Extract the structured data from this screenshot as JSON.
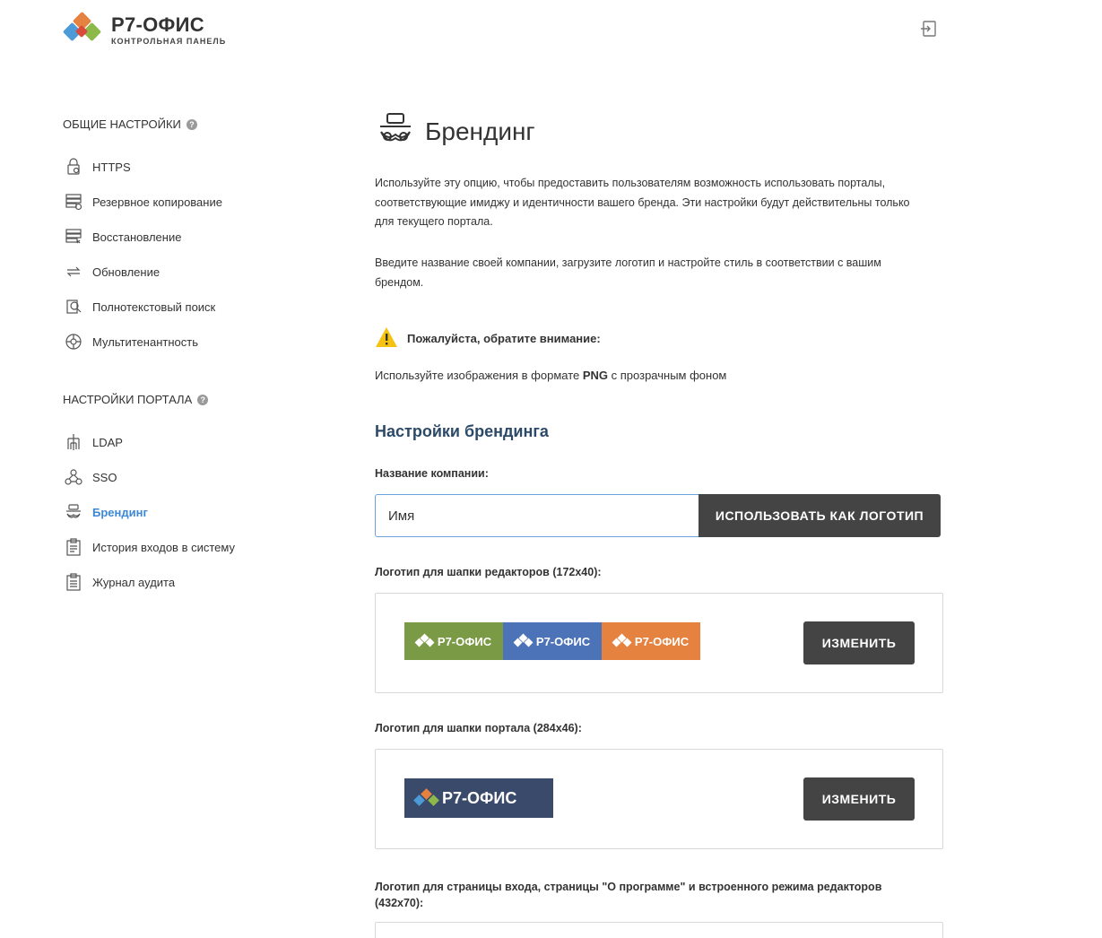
{
  "header": {
    "app_title": "Р7-ОФИС",
    "app_subtitle": "КОНТРОЛЬНАЯ ПАНЕЛЬ",
    "logout_icon": "logout-icon"
  },
  "sidebar": {
    "general_heading": "ОБЩИЕ НАСТРОЙКИ",
    "general_items": [
      {
        "label": "HTTPS",
        "icon": "lock-icon"
      },
      {
        "label": "Резервное копирование",
        "icon": "backup-icon"
      },
      {
        "label": "Восстановление",
        "icon": "restore-icon"
      },
      {
        "label": "Обновление",
        "icon": "update-icon"
      },
      {
        "label": "Полнотекстовый поиск",
        "icon": "search-doc-icon"
      },
      {
        "label": "Мультитенантность",
        "icon": "multitenancy-icon"
      }
    ],
    "portal_heading": "НАСТРОЙКИ ПОРТАЛА",
    "portal_items": [
      {
        "label": "LDAP",
        "icon": "ldap-icon"
      },
      {
        "label": "SSO",
        "icon": "sso-icon"
      },
      {
        "label": "Брендинг",
        "icon": "branding-icon",
        "active": true
      },
      {
        "label": "История входов в систему",
        "icon": "login-history-icon"
      },
      {
        "label": "Журнал аудита",
        "icon": "audit-log-icon"
      }
    ]
  },
  "main": {
    "title": "Брендинг",
    "intro": "Используйте эту опцию, чтобы предоставить пользователям возможность использовать порталы, соответствующие имиджу и идентичности вашего бренда. Эти настройки будут действительны только для текущего портала.",
    "instructions": "Введите название своей компании, загрузите логотип и настройте стиль в соответствии с вашим брендом.",
    "warning_title": "Пожалуйста, обратите внимание:",
    "png_prefix": "Используйте изображения в формате ",
    "png_bold": "PNG",
    "png_suffix": " с прозрачным фоном",
    "section_title": "Настройки брендинга",
    "company_label": "Название компании:",
    "company_value": "Имя",
    "use_as_logo_label": "ИСПОЛЬЗОВАТЬ КАК ЛОГОТИП",
    "editors_logo_label": "Логотип для шапки редакторов (172x40):",
    "editors_logo_text": "Р7-ОФИС",
    "change_label": "ИЗМЕНИТЬ",
    "portal_logo_label": "Логотип для шапки портала (284x46):",
    "portal_logo_text": "Р7-ОФИС",
    "login_logo_label": "Логотип для страницы входа, страницы \"О программе\" и встроенного режима редакторов (432x70):"
  },
  "colors": {
    "accent": "#3d88d5",
    "button_dark": "#444444",
    "logo_green": "#7a9a45",
    "logo_blue": "#4c72b8",
    "logo_orange": "#e6823f",
    "portal_logo_bg": "#3a4a6b",
    "warning": "#f5c211"
  }
}
